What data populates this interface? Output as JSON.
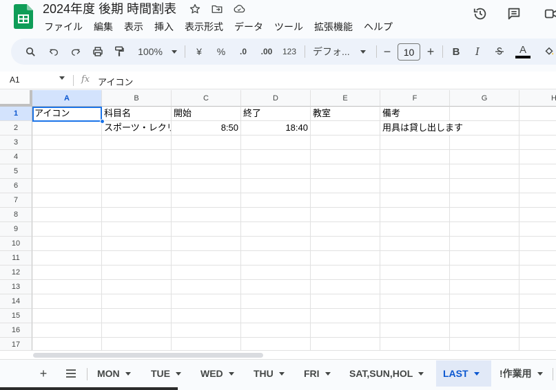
{
  "document": {
    "title": "2024年度 後期 時間割表"
  },
  "menu": [
    "ファイル",
    "編集",
    "表示",
    "挿入",
    "表示形式",
    "データ",
    "ツール",
    "拡張機能",
    "ヘルプ"
  ],
  "toolbar": {
    "zoom": "100%",
    "currency": "¥",
    "percent": "%",
    "decrease_decimal": ".0",
    "increase_decimal": ".00",
    "number_format": "123",
    "font": "デフォ...",
    "font_size": "10",
    "bold": "B",
    "italic": "I",
    "text_color": "A"
  },
  "formula_bar": {
    "cell_ref": "A1",
    "fx": "fx",
    "value": "アイコン"
  },
  "grid": {
    "columns": [
      "A",
      "B",
      "C",
      "D",
      "E",
      "F",
      "G",
      "H"
    ],
    "rows": [
      "1",
      "2",
      "3",
      "4",
      "5",
      "6",
      "7",
      "8",
      "9",
      "10",
      "11",
      "12",
      "13",
      "14",
      "15",
      "16",
      "17"
    ],
    "header_row": [
      "アイコン",
      "科目名",
      "開始",
      "終了",
      "教室",
      "備考"
    ],
    "data_row": {
      "a": "",
      "b": "スポーツ・レクリエーション",
      "c": "8:50",
      "d": "18:40",
      "e": "",
      "f": "用具は貸し出します"
    }
  },
  "tabs": [
    "MON",
    "TUE",
    "WED",
    "THU",
    "FRI",
    "SAT,SUN,HOL",
    "LAST",
    "!作業用"
  ],
  "active_tab": "LAST",
  "colors": {
    "accent": "#0b57d0",
    "sheets_green": "#0f9d58",
    "selection": "#1a73e8"
  },
  "icons": {
    "star": "star-icon",
    "move": "move-to-folder-icon",
    "cloud": "cloud-status-icon",
    "history": "history-icon",
    "comments": "comments-icon",
    "meet": "meet-icon"
  }
}
